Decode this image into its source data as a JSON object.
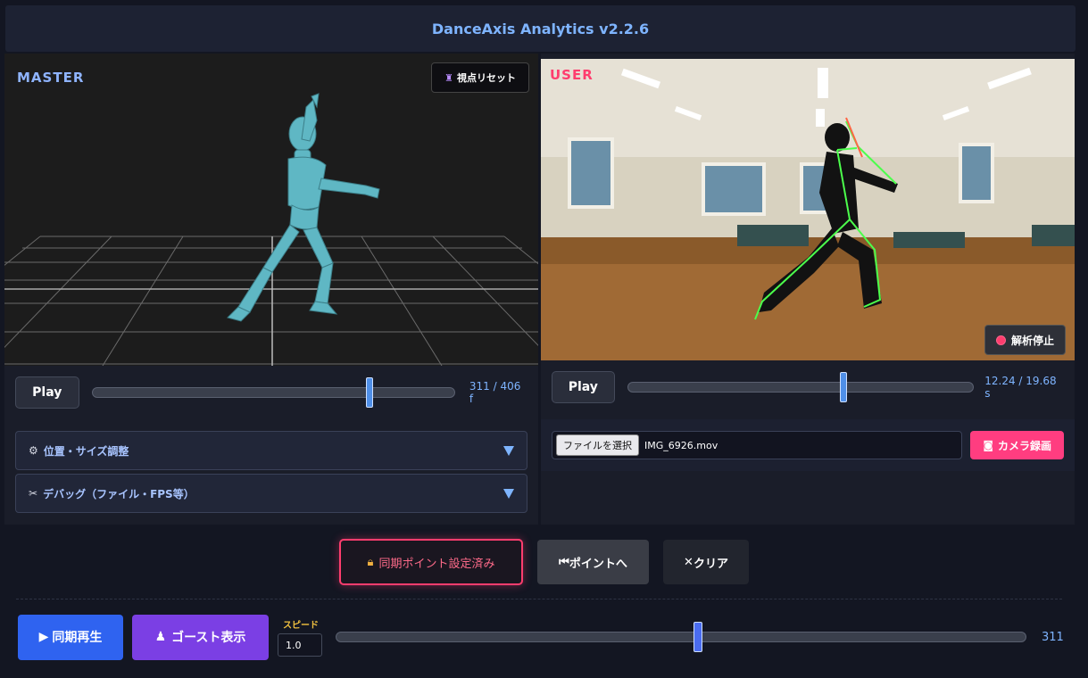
{
  "header": {
    "title": "DanceAxis Analytics v2.2.6"
  },
  "master": {
    "label": "MASTER",
    "reset_label": "視点リセット",
    "play_label": "Play",
    "progress": 0.766,
    "time": "311 / 406 f",
    "accordion1": "位置・サイズ調整",
    "accordion2": "デバッグ（ファイル・FPS等）"
  },
  "user": {
    "label": "USER",
    "stop_label": "解析停止",
    "play_label": "Play",
    "progress": 0.622,
    "time": "12.24 / 19.68 s",
    "file_button": "ファイルを選択",
    "file_name": "IMG_6926.mov",
    "camera_label": "カメラ録画"
  },
  "sync": {
    "set_label": "同期ポイント設定済み",
    "to_point_label": "ポイントへ",
    "clear_label": "クリア"
  },
  "bottom": {
    "sync_play_label": "同期再生",
    "ghost_label": "ゴースト表示",
    "speed_label": "スピード",
    "speed_value": "1.0",
    "frame_value": "311"
  },
  "colors": {
    "accent": "#7eb4ff",
    "user_label": "#ff3d6e",
    "sync_play": "#2f63f0",
    "ghost": "#7b3fe4",
    "camera": "#ff3d80"
  }
}
